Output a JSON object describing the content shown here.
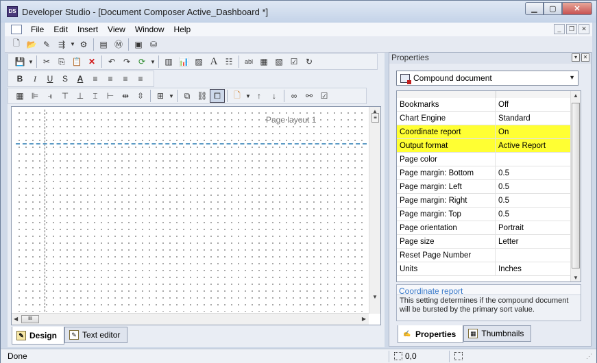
{
  "window": {
    "title": "Developer Studio - [Document Composer Active_Dashboard *]",
    "app_icon_text": "DS"
  },
  "menu": {
    "items": [
      "File",
      "Edit",
      "Insert",
      "View",
      "Window",
      "Help"
    ]
  },
  "toolbar_main": {
    "icons": [
      "new-icon",
      "open-icon",
      "edit-icon",
      "deploy-icon",
      "dropdown-icon",
      "run-icon",
      "list-icon",
      "report-icon",
      "console-icon",
      "database-icon"
    ]
  },
  "toolbar_format_1": {
    "icons": [
      "save-icon",
      "dropdown-icon",
      "cut-icon",
      "copy-icon",
      "paste-icon",
      "delete-icon",
      "undo-icon",
      "redo-icon",
      "refresh-icon",
      "dropdown-icon",
      "report-icon",
      "chart-icon",
      "image-icon",
      "text-icon",
      "table-icon",
      "textbox-icon",
      "form-icon",
      "form2-icon",
      "checkbox-icon",
      "link-icon"
    ]
  },
  "toolbar_format_2": {
    "bold": "B",
    "italic": "I",
    "underline": "U",
    "strike": "S",
    "font_color": "A"
  },
  "canvas": {
    "page_label": "Page layout 1"
  },
  "tabs_left": {
    "design": "Design",
    "text_editor": "Text editor"
  },
  "properties": {
    "panel_title": "Properties",
    "selected_object": "Compound document",
    "rows": [
      {
        "name": "Bookmarks",
        "value": "Off",
        "highlight": false
      },
      {
        "name": "Chart Engine",
        "value": "Standard",
        "highlight": false
      },
      {
        "name": "Coordinate report",
        "value": "On",
        "highlight": true
      },
      {
        "name": "Output format",
        "value": "Active Report",
        "highlight": true
      },
      {
        "name": "Page color",
        "value": "",
        "highlight": false
      },
      {
        "name": "Page margin: Bottom",
        "value": "0.5",
        "highlight": false
      },
      {
        "name": "Page margin: Left",
        "value": "0.5",
        "highlight": false
      },
      {
        "name": "Page margin: Right",
        "value": "0.5",
        "highlight": false
      },
      {
        "name": "Page margin: Top",
        "value": "0.5",
        "highlight": false
      },
      {
        "name": "Page orientation",
        "value": "Portrait",
        "highlight": false
      },
      {
        "name": "Page size",
        "value": "Letter",
        "highlight": false
      },
      {
        "name": "Reset Page Number",
        "value": "",
        "highlight": false
      },
      {
        "name": "Units",
        "value": "Inches",
        "highlight": false
      }
    ],
    "description_title": "Coordinate report",
    "description_body": "This setting determines if the compound document will be bursted by the primary sort value."
  },
  "tabs_right": {
    "properties": "Properties",
    "thumbnails": "Thumbnails"
  },
  "status": {
    "text": "Done",
    "coordinates": "0,0"
  },
  "colors": {
    "highlight": "#ffff33",
    "link_blue": "#3878c8",
    "page_break": "#5d9bc5"
  }
}
